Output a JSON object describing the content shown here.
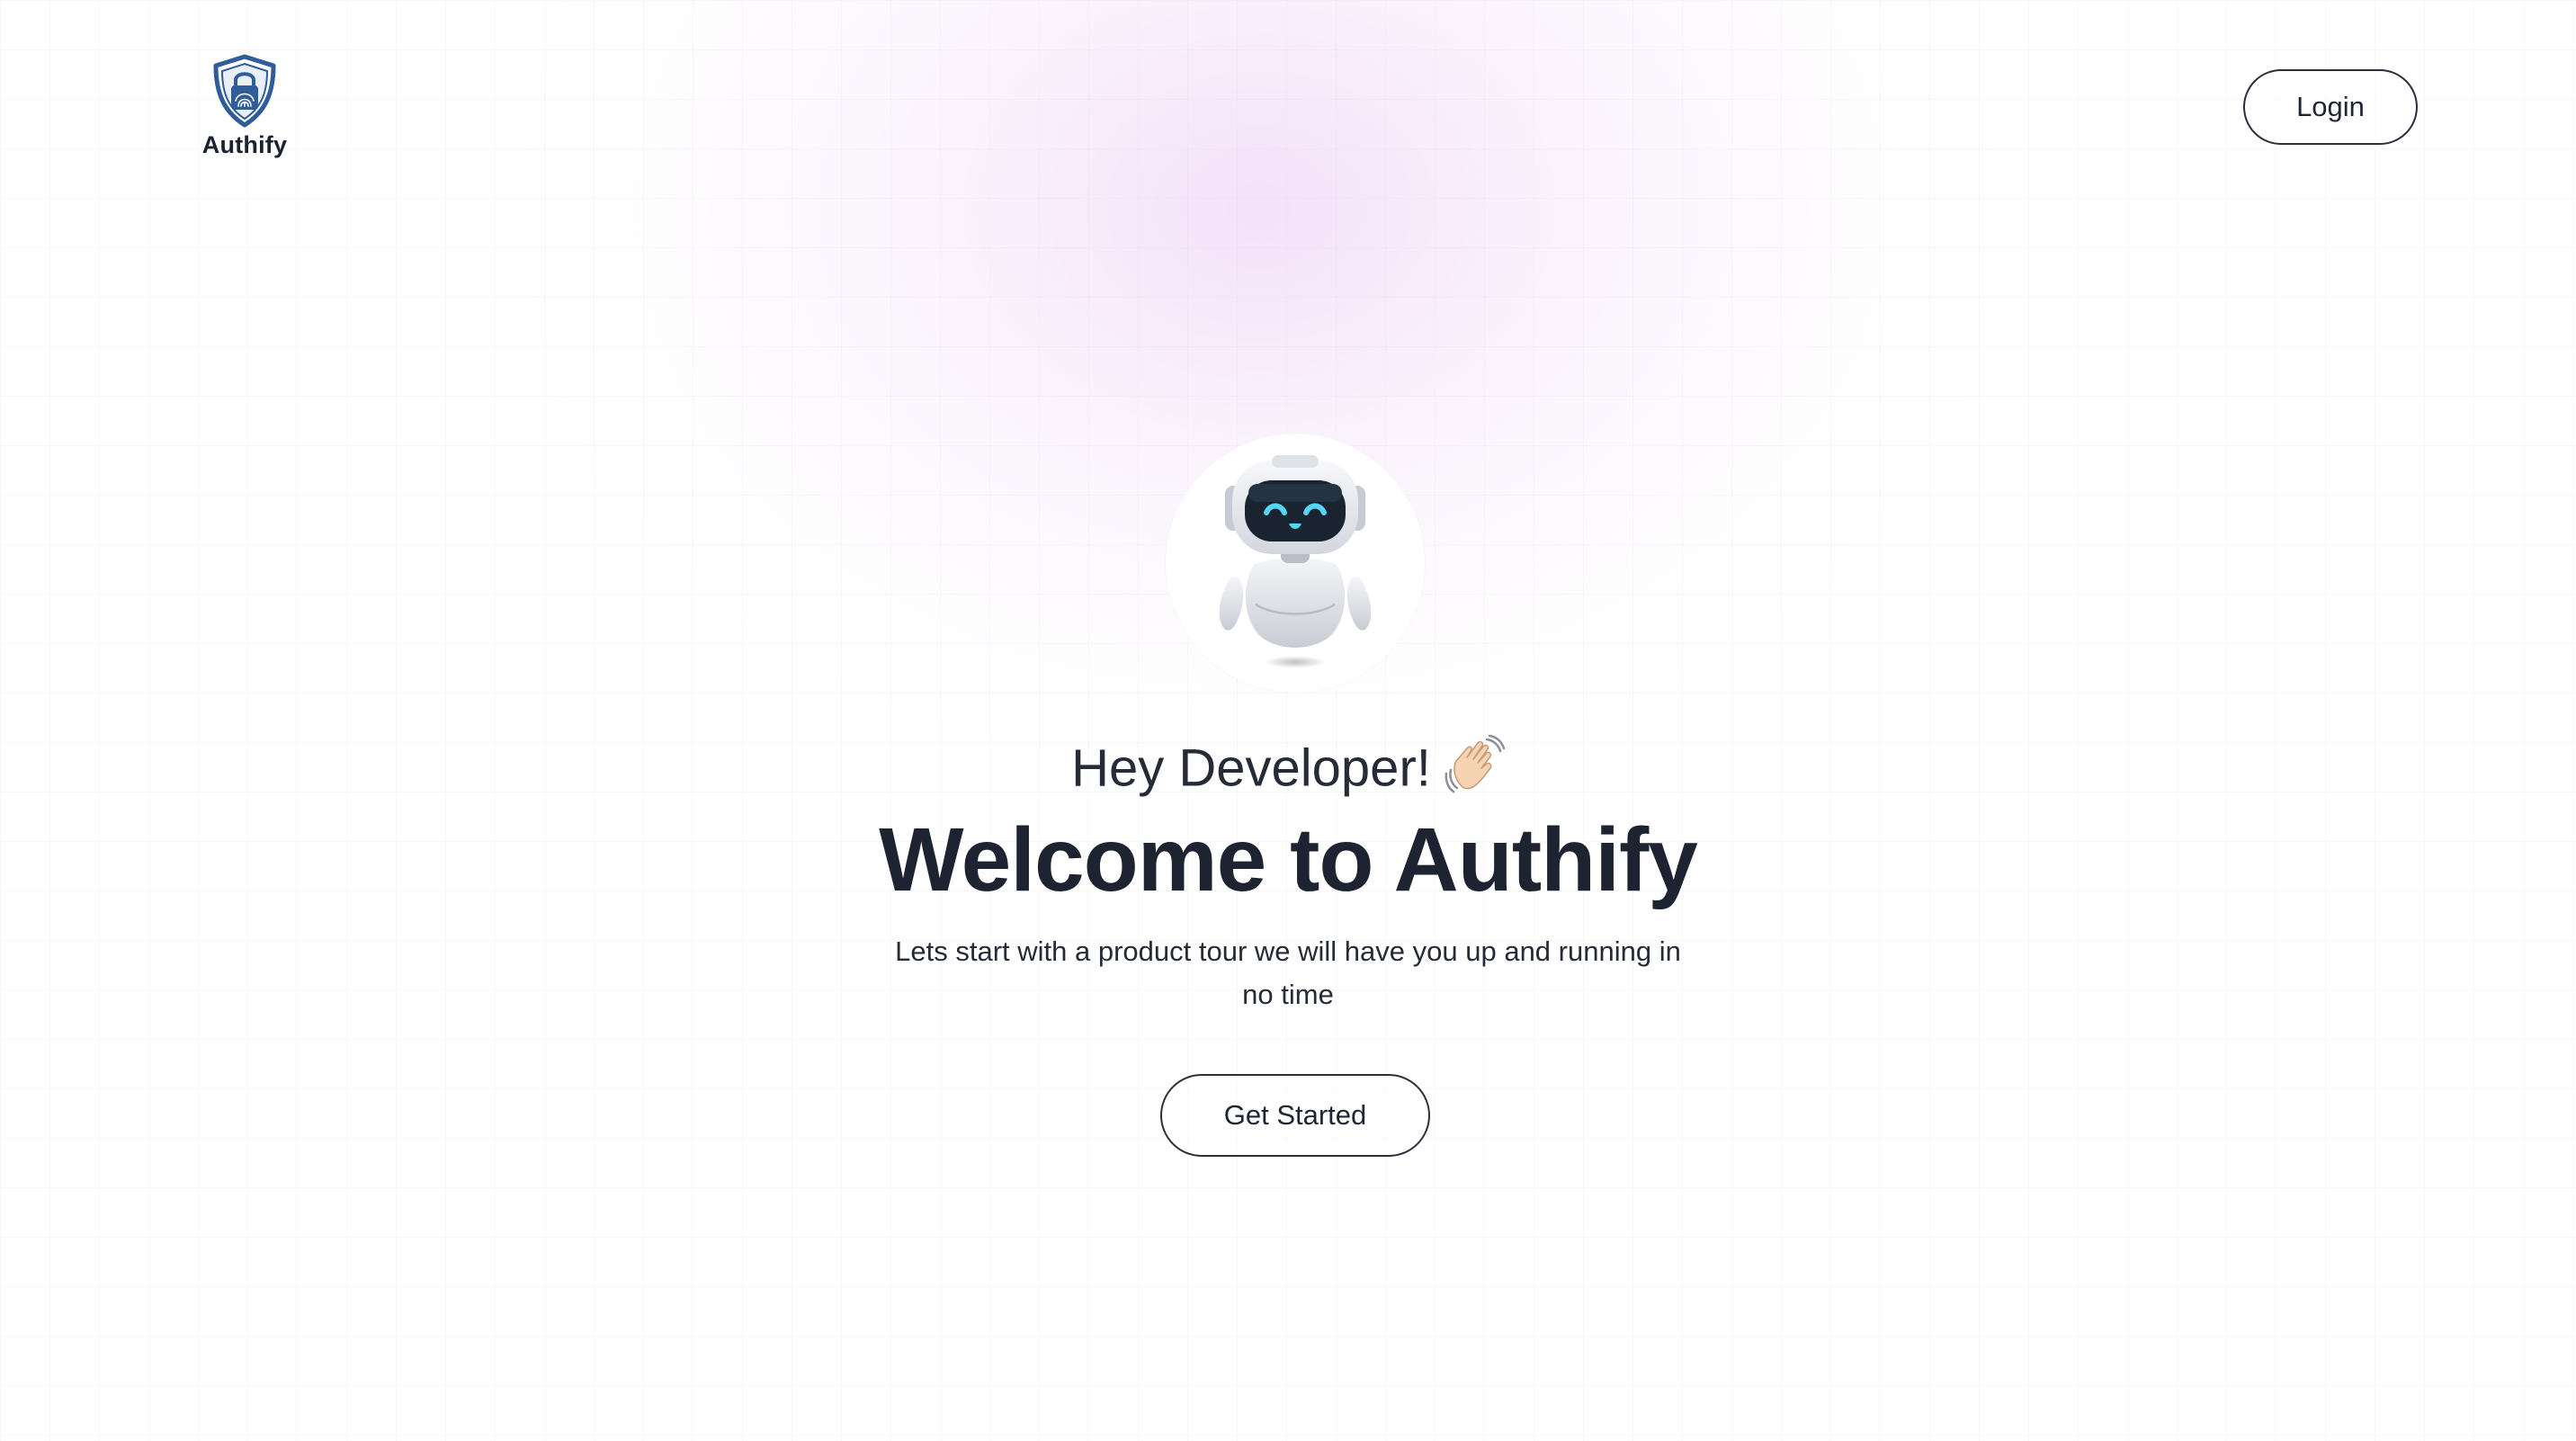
{
  "brand": {
    "name": "Authify",
    "logo_icon": "shield-fingerprint-icon",
    "color": "#2f5d99"
  },
  "header": {
    "login_label": "Login"
  },
  "hero": {
    "mascot_icon": "robot-icon",
    "greeting": "Hey Developer!",
    "greeting_icon": "waving-hand-icon",
    "headline": "Welcome to Authify",
    "subtitle": "Lets start with a product tour we will have you up and running in no time",
    "cta_label": "Get Started"
  },
  "colors": {
    "text": "#1d2330",
    "glow": "#ebc8f5"
  }
}
